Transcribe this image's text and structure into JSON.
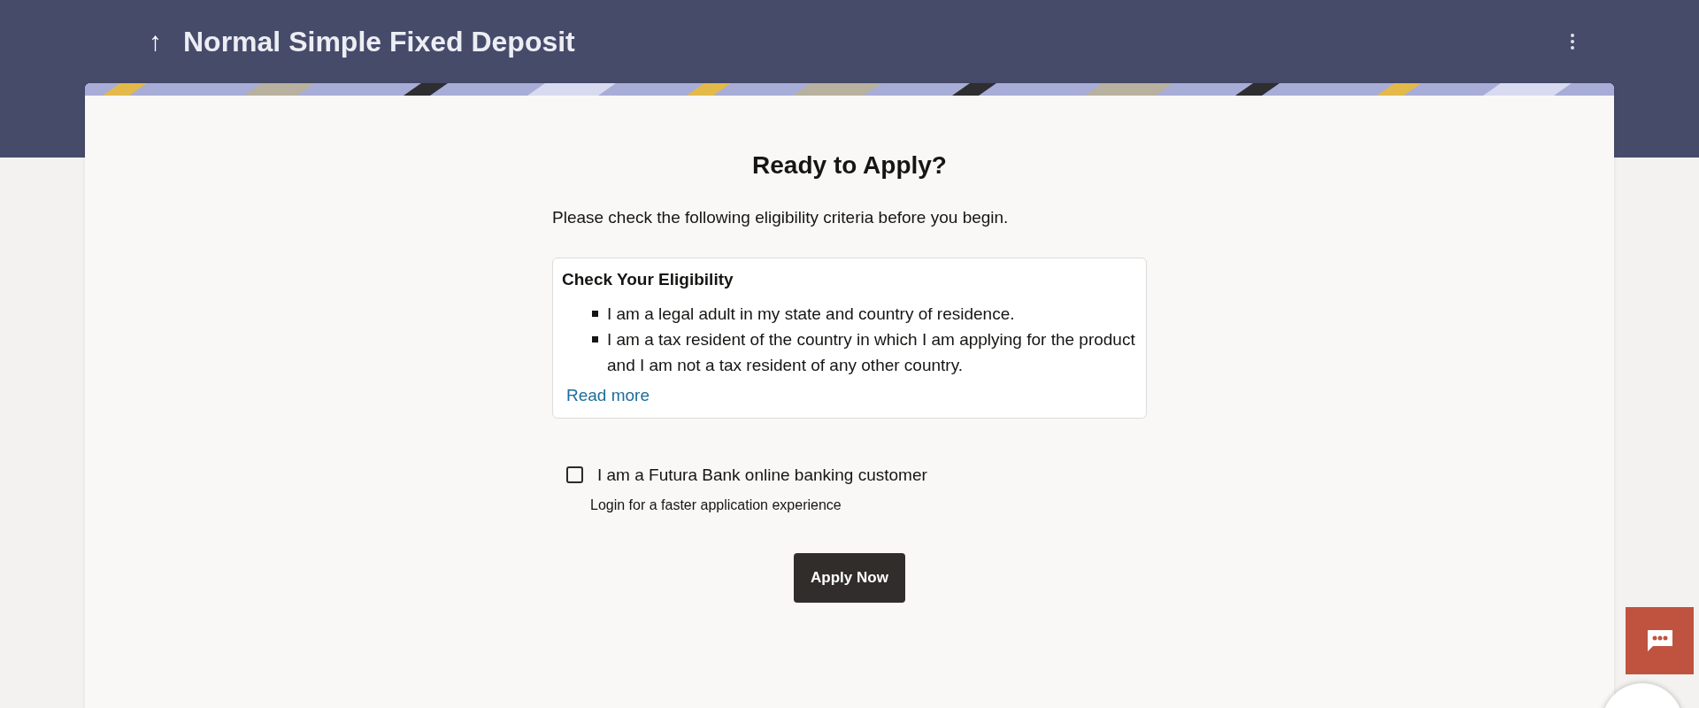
{
  "header": {
    "back_symbol": "↑",
    "title": "Normal Simple Fixed Deposit"
  },
  "heading": "Ready to Apply?",
  "intro": "Please check the following eligibility criteria before you begin.",
  "eligibility": {
    "title": "Check Your Eligibility",
    "items": [
      "I am a legal adult in my state and country of residence.",
      "I am a tax resident of the country in which I am applying for the product and I am not a tax resident of any other country."
    ],
    "link": "Read more"
  },
  "customer_checkbox": {
    "label": "I am a Futura Bank online banking customer",
    "checked": false,
    "hint": "Login for a faster application experience"
  },
  "apply_button": "Apply Now"
}
